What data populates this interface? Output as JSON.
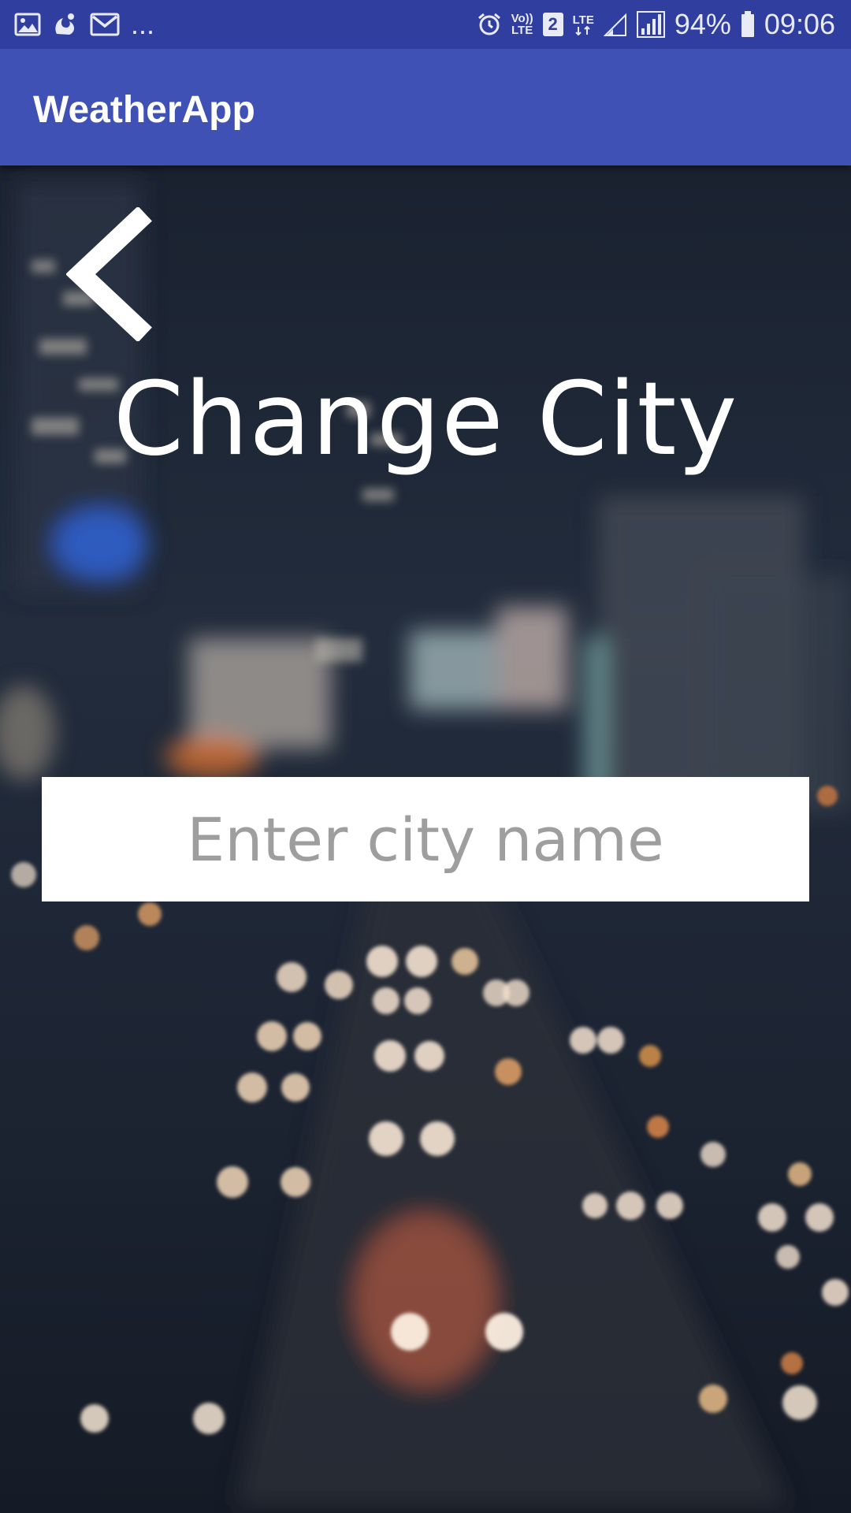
{
  "status_bar": {
    "left_icons": [
      "image-icon",
      "uc-browser-icon",
      "gmail-icon"
    ],
    "overflow": "...",
    "volte_top": "Vo))",
    "volte_bottom": "LTE",
    "sim_slot": "2",
    "network_type": "LTE",
    "battery_percent": "94%",
    "time": "09:06"
  },
  "app_bar": {
    "title": "WeatherApp",
    "color": "#3f51b5",
    "status_color": "#303f9f"
  },
  "page": {
    "back_icon": "chevron-left-icon",
    "title": "Change City",
    "background": "night-city-traffic-bokeh-photo"
  },
  "city_input": {
    "placeholder": "Enter city name",
    "value": ""
  }
}
